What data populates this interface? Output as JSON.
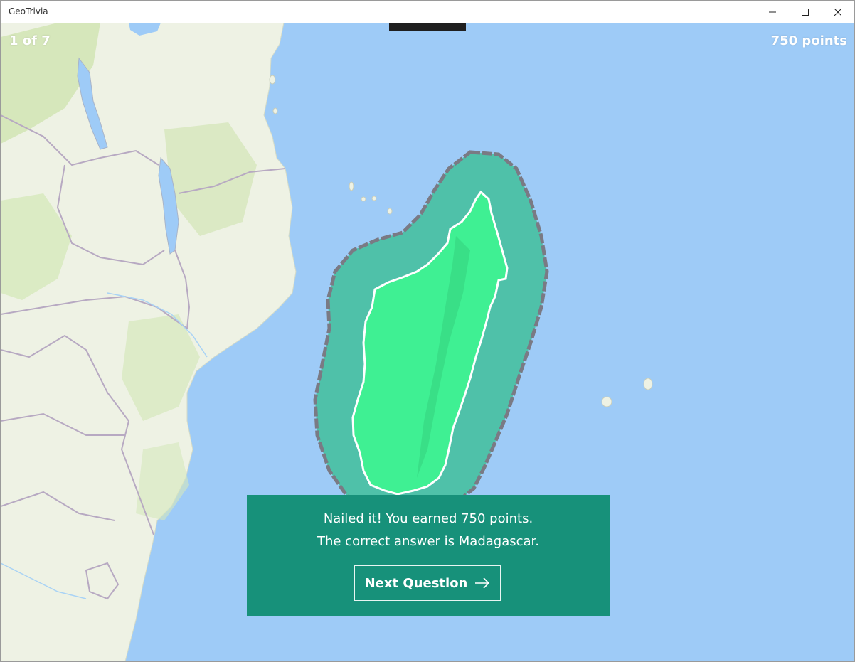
{
  "window": {
    "title": "GeoTrivia",
    "controls": {
      "minimize_icon": "minimize-icon",
      "maximize_icon": "maximize-icon",
      "close_icon": "close-icon"
    }
  },
  "quiz": {
    "progress": "1 of 7",
    "score": "750 points"
  },
  "result": {
    "message": "Nailed it!  You earned 750 points.",
    "answer": "The correct answer is Madagascar.",
    "next_button_label": "Next Question",
    "next_icon": "arrow-right-icon"
  },
  "colors": {
    "ocean": "#9ecbf7",
    "land": "#eef2e4",
    "highlight_zone": "#4fc1a9",
    "highlight_country": "#3ff093",
    "panel": "#17917a"
  }
}
